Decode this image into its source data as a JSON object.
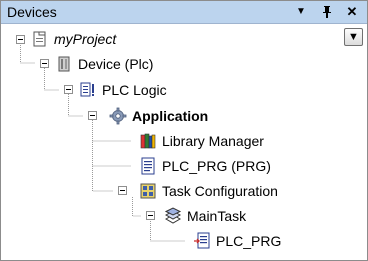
{
  "panel": {
    "title": "Devices",
    "controls": {
      "dropdown": "▼",
      "pin": "⊥",
      "close": "✕"
    }
  },
  "toolbar": {
    "dropdown_glyph": "▼"
  },
  "tree": {
    "items": [
      {
        "label": "myProject",
        "icon": "project-icon",
        "italic": true,
        "bold": false
      },
      {
        "label": "Device (Plc)",
        "icon": "device-icon",
        "italic": false,
        "bold": false
      },
      {
        "label": "PLC Logic",
        "icon": "plc-logic-icon",
        "italic": false,
        "bold": false
      },
      {
        "label": "Application",
        "icon": "application-gear-icon",
        "italic": false,
        "bold": true
      },
      {
        "label": "Library Manager",
        "icon": "library-books-icon",
        "italic": false,
        "bold": false
      },
      {
        "label": "PLC_PRG (PRG)",
        "icon": "program-document-icon",
        "italic": false,
        "bold": false
      },
      {
        "label": "Task Configuration",
        "icon": "task-configuration-icon",
        "italic": false,
        "bold": false
      },
      {
        "label": "MainTask",
        "icon": "main-task-icon",
        "italic": false,
        "bold": false
      },
      {
        "label": "PLC_PRG",
        "icon": "program-call-icon",
        "italic": false,
        "bold": false
      }
    ]
  }
}
